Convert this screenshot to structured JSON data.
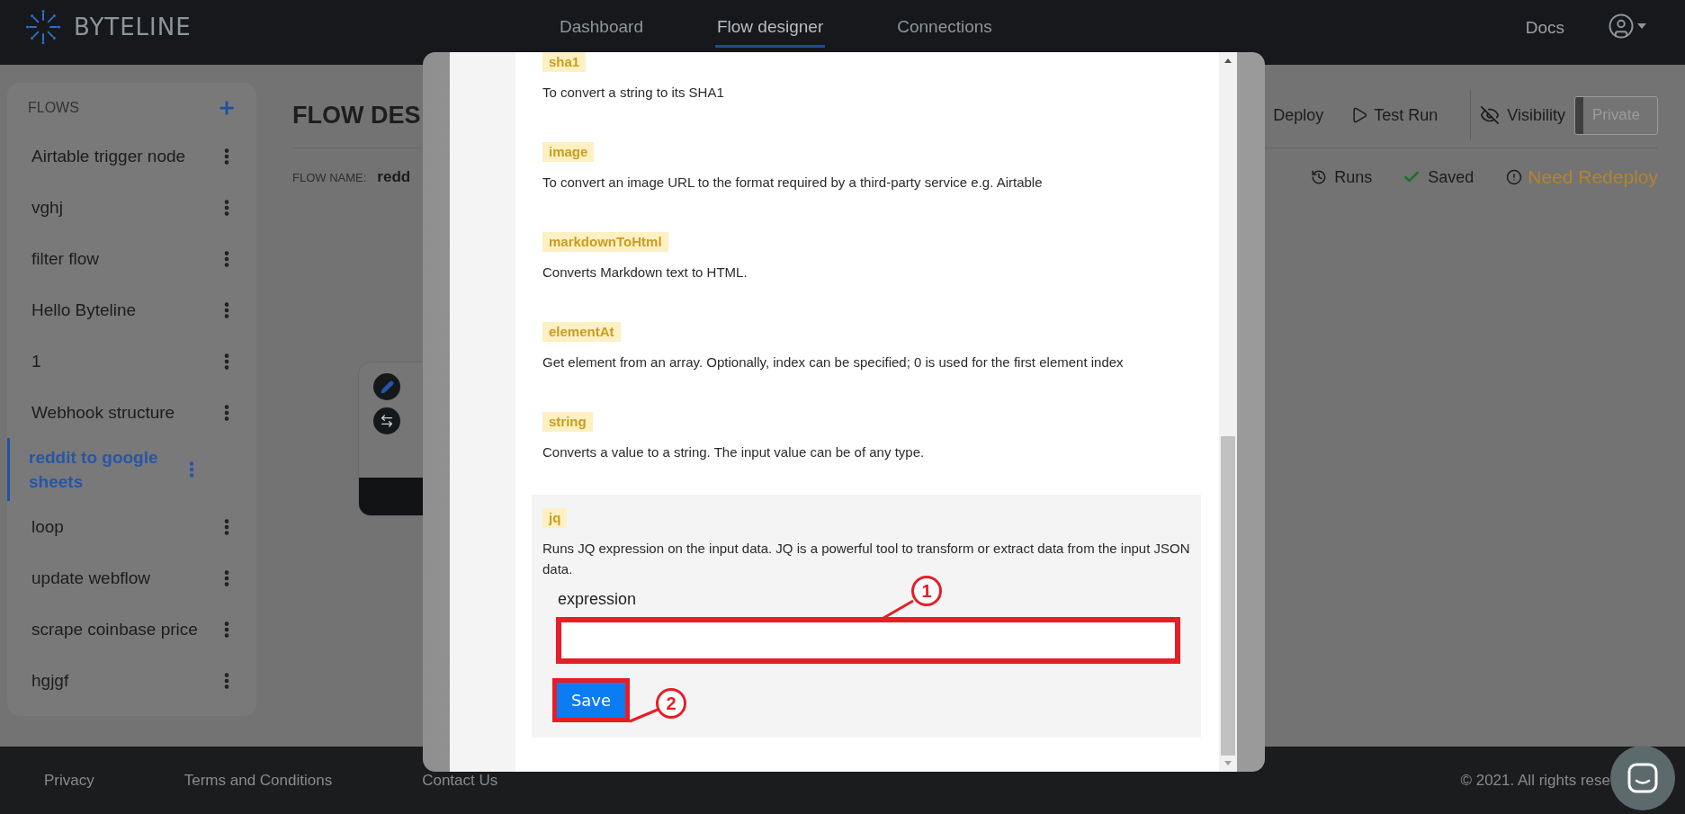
{
  "header": {
    "logo_text": "BYTELINE",
    "nav": [
      {
        "label": "Dashboard",
        "selected": false
      },
      {
        "label": "Flow designer",
        "selected": true
      },
      {
        "label": "Connections",
        "selected": false
      }
    ],
    "docs_link": "Docs"
  },
  "sidebar": {
    "title": "FLOWS",
    "items": [
      {
        "label": "Airtable trigger node",
        "selected": false
      },
      {
        "label": "vghj",
        "selected": false
      },
      {
        "label": "filter flow",
        "selected": false
      },
      {
        "label": "Hello Byteline",
        "selected": false
      },
      {
        "label": "1",
        "selected": false
      },
      {
        "label": "Webhook structure",
        "selected": false
      },
      {
        "label": "reddit to google sheets",
        "selected": true
      },
      {
        "label": "loop",
        "selected": false
      },
      {
        "label": "update webflow",
        "selected": false
      },
      {
        "label": "scrape coinbase price",
        "selected": false
      },
      {
        "label": "hgjgf",
        "selected": false
      }
    ]
  },
  "page": {
    "title": "FLOW DES",
    "deploy": "Deploy",
    "test_run": "Test Run",
    "visibility": "Visibility",
    "visibility_toggle": "Private",
    "flow_name_label": "FLOW NAME:",
    "flow_name": "redd",
    "runs": "Runs",
    "saved": "Saved",
    "warning": "Need Redeploy"
  },
  "modal": {
    "functions": [
      {
        "name": "sha1",
        "description": "To convert a string to its SHA1"
      },
      {
        "name": "image",
        "description": "To convert an image URL to the format required by a third-party service e.g. Airtable"
      },
      {
        "name": "markdownToHtml",
        "description": "Converts Markdown text to HTML."
      },
      {
        "name": "elementAt",
        "description": "Get element from an array. Optionally, index can be specified; 0 is used for the first element index"
      },
      {
        "name": "string",
        "description": "Converts a value to a string. The input value can be of any type."
      }
    ],
    "active_function": {
      "name": "jq",
      "description": "Runs JQ expression on the input data. JQ is a powerful tool to transform or extract data from the input JSON data.",
      "field_label": "expression",
      "button": "Save"
    },
    "callouts": [
      "1",
      "2"
    ]
  },
  "footer": {
    "links": [
      "Privacy",
      "Terms and Conditions",
      "Contact Us"
    ],
    "copyright": "© 2021. All rights rese"
  }
}
